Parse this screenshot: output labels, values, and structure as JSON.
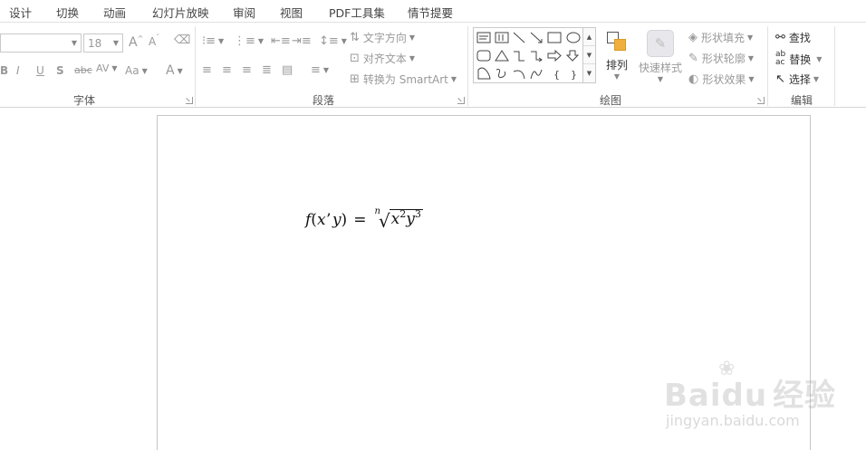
{
  "tabs": [
    "设计",
    "切换",
    "动画",
    "幻灯片放映",
    "审阅",
    "视图",
    "PDF工具集",
    "情节提要"
  ],
  "font_group": {
    "label": "字体",
    "font_size": "18",
    "bold": "B",
    "italic": "I",
    "underline": "U",
    "shadow": "S",
    "strike": "abc",
    "spacing": "AV",
    "case": "Aa",
    "color": "A",
    "grow": "A",
    "shrink": "A"
  },
  "paragraph_group": {
    "label": "段落",
    "text_direction": "文字方向",
    "align_text": "对齐文本",
    "convert_smartart": "转换为 SmartArt"
  },
  "drawing_group": {
    "label": "绘图",
    "arrange": "排列",
    "quick_styles": "快速样式",
    "shape_fill": "形状填充",
    "shape_outline": "形状轮廓",
    "shape_effects": "形状效果"
  },
  "editing_group": {
    "label": "编辑",
    "find": "查找",
    "replace": "替换",
    "select": "选择"
  },
  "slide": {
    "formula": {
      "f": "f",
      "open": "(",
      "x": "x",
      "comma": "ʼ",
      "y": "y",
      "close": ")",
      "eq": "=",
      "root_index": "n",
      "radicand_x": "x",
      "exp_x": "2",
      "radicand_y": "y",
      "exp_y": "3"
    }
  },
  "watermark": {
    "brand_left": "Bai",
    "brand_mid": "du",
    "brand_right": "经验",
    "url": "jingyan.baidu.com"
  }
}
